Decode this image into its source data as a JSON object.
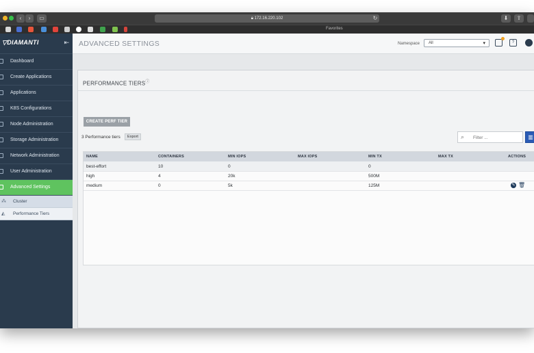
{
  "browser": {
    "url": "172.16.220.102",
    "favorites_label": "Favorites"
  },
  "sidebar": {
    "brand": "DIAMANTI",
    "items": [
      {
        "label": "Dashboard"
      },
      {
        "label": "Create Applications"
      },
      {
        "label": "Applications"
      },
      {
        "label": "K8S Configurations"
      },
      {
        "label": "Node Administration"
      },
      {
        "label": "Storage Administration"
      },
      {
        "label": "Network Administration"
      },
      {
        "label": "User Administration"
      },
      {
        "label": "Advanced Settings"
      }
    ],
    "subitems": [
      {
        "label": "Cluster"
      },
      {
        "label": "Performance Tiers"
      }
    ]
  },
  "header": {
    "title": "ADVANCED SETTINGS",
    "namespace_label": "Namespace",
    "namespace_value": "All"
  },
  "section": {
    "title": "PERFORMANCE TIERS",
    "create_button": "CREATE PERF TIER",
    "count_text": "3 Performance tiers",
    "export_button": "Export",
    "filter_placeholder": "Filter ..."
  },
  "table": {
    "columns": [
      "NAME",
      "CONTAINERS",
      "MIN IOPS",
      "MAX IOPS",
      "MIN TX",
      "MAX TX",
      "ACTIONS"
    ],
    "rows": [
      {
        "name": "best-effort",
        "containers": "10",
        "min_iops": "0",
        "max_iops": "",
        "min_tx": "0",
        "max_tx": ""
      },
      {
        "name": "high",
        "containers": "4",
        "min_iops": "20k",
        "max_iops": "",
        "min_tx": "500M",
        "max_tx": ""
      },
      {
        "name": "medium",
        "containers": "0",
        "min_iops": "5k",
        "max_iops": "",
        "min_tx": "125M",
        "max_tx": ""
      }
    ]
  },
  "colors": {
    "sidebar_bg": "#2a3b4d",
    "active_nav": "#5fc35f",
    "accent_blue": "#2a5bb5"
  }
}
